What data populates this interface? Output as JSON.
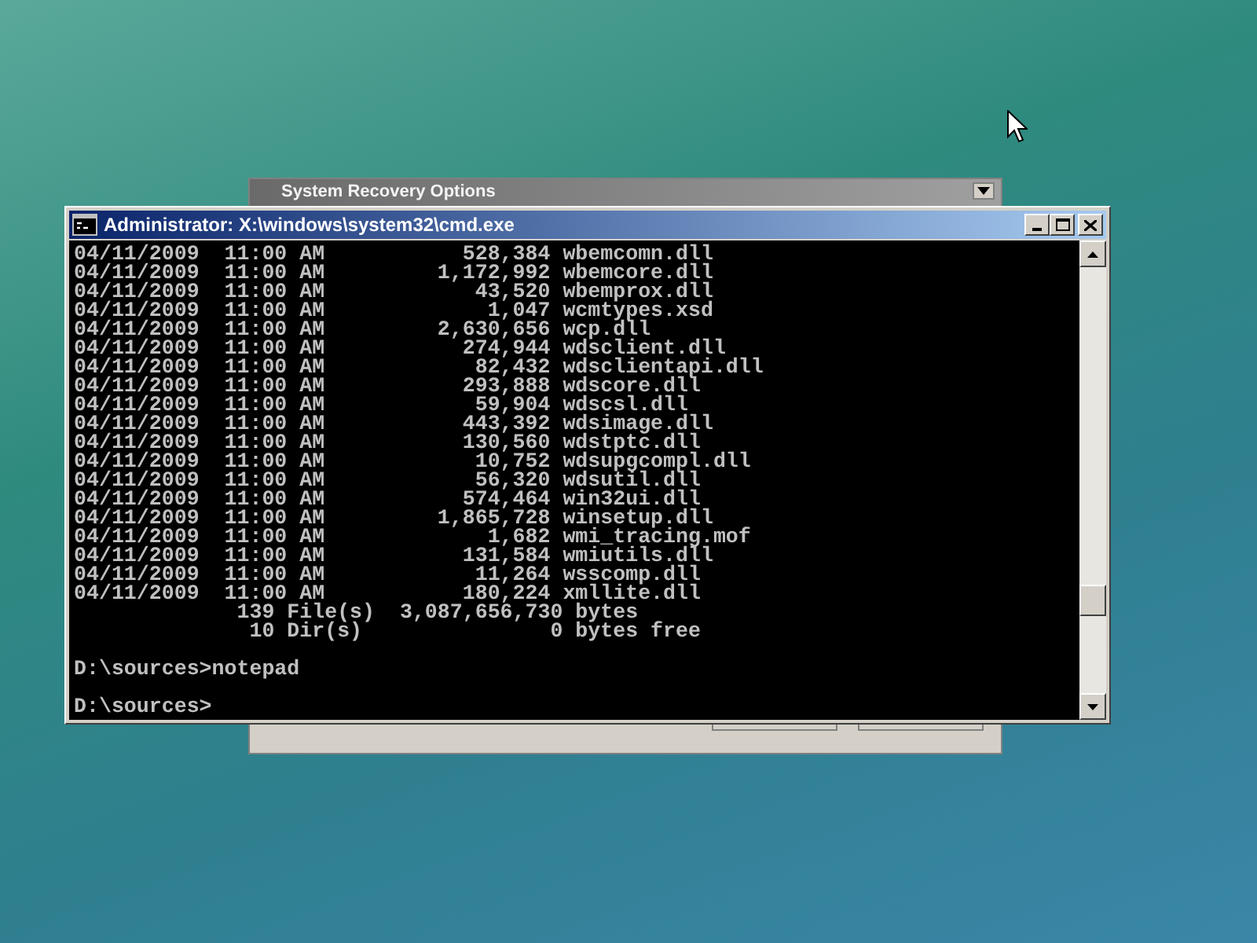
{
  "background_window": {
    "title": "System Recovery Options"
  },
  "window": {
    "title": "Administrator: X:\\windows\\system32\\cmd.exe"
  },
  "console": {
    "listing": [
      "04/11/2009  11:00 AM           528,384 wbemcomn.dll",
      "04/11/2009  11:00 AM         1,172,992 wbemcore.dll",
      "04/11/2009  11:00 AM            43,520 wbemprox.dll",
      "04/11/2009  11:00 AM             1,047 wcmtypes.xsd",
      "04/11/2009  11:00 AM         2,630,656 wcp.dll",
      "04/11/2009  11:00 AM           274,944 wdsclient.dll",
      "04/11/2009  11:00 AM            82,432 wdsclientapi.dll",
      "04/11/2009  11:00 AM           293,888 wdscore.dll",
      "04/11/2009  11:00 AM            59,904 wdscsl.dll",
      "04/11/2009  11:00 AM           443,392 wdsimage.dll",
      "04/11/2009  11:00 AM           130,560 wdstptc.dll",
      "04/11/2009  11:00 AM            10,752 wdsupgcompl.dll",
      "04/11/2009  11:00 AM            56,320 wdsutil.dll",
      "04/11/2009  11:00 AM           574,464 win32ui.dll",
      "04/11/2009  11:00 AM         1,865,728 winsetup.dll",
      "04/11/2009  11:00 AM             1,682 wmi_tracing.mof",
      "04/11/2009  11:00 AM           131,584 wmiutils.dll",
      "04/11/2009  11:00 AM            11,264 wsscomp.dll",
      "04/11/2009  11:00 AM           180,224 xmllite.dll",
      "             139 File(s)  3,087,656,730 bytes",
      "              10 Dir(s)               0 bytes free"
    ],
    "commands": [
      "D:\\sources>notepad",
      "D:\\sources>"
    ]
  }
}
